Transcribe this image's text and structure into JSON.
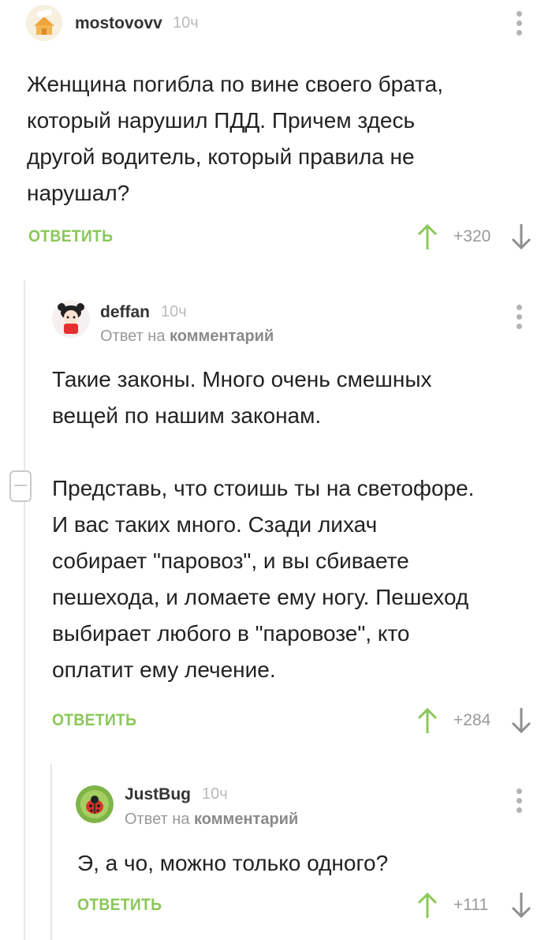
{
  "accent_color": "#8ac858",
  "comments": [
    {
      "username": "mostovovv",
      "time": "10ч",
      "text": [
        "Женщина погибла по вине своего брата,",
        "который нарушил ПДД. Причем здесь",
        "другой водитель, который правила не",
        "нарушал?"
      ],
      "reply_label": "ОТВЕТИТЬ",
      "rating": "+320"
    },
    {
      "username": "deffan",
      "time": "10ч",
      "reply_prefix": "Ответ на",
      "reply_target": "комментарий",
      "text_p1": [
        "Такие законы. Много очень смешных",
        "вещей по нашим законам."
      ],
      "text_p2": [
        "Представь, что стоишь ты на светофоре.",
        "И вас таких много. Сзади лихач",
        "собирает \"паровоз\", и вы сбиваете",
        "пешехода, и ломаете ему ногу. Пешеход",
        "выбирает любого в \"паровозе\", кто",
        "оплатит ему лечение."
      ],
      "reply_label": "ОТВЕТИТЬ",
      "rating": "+284"
    },
    {
      "username": "JustBug",
      "time": "10ч",
      "reply_prefix": "Ответ на",
      "reply_target": "комментарий",
      "text": [
        "Э, а чо, можно только одного?"
      ],
      "reply_label": "ОТВЕТИТЬ",
      "rating": "+111"
    }
  ]
}
